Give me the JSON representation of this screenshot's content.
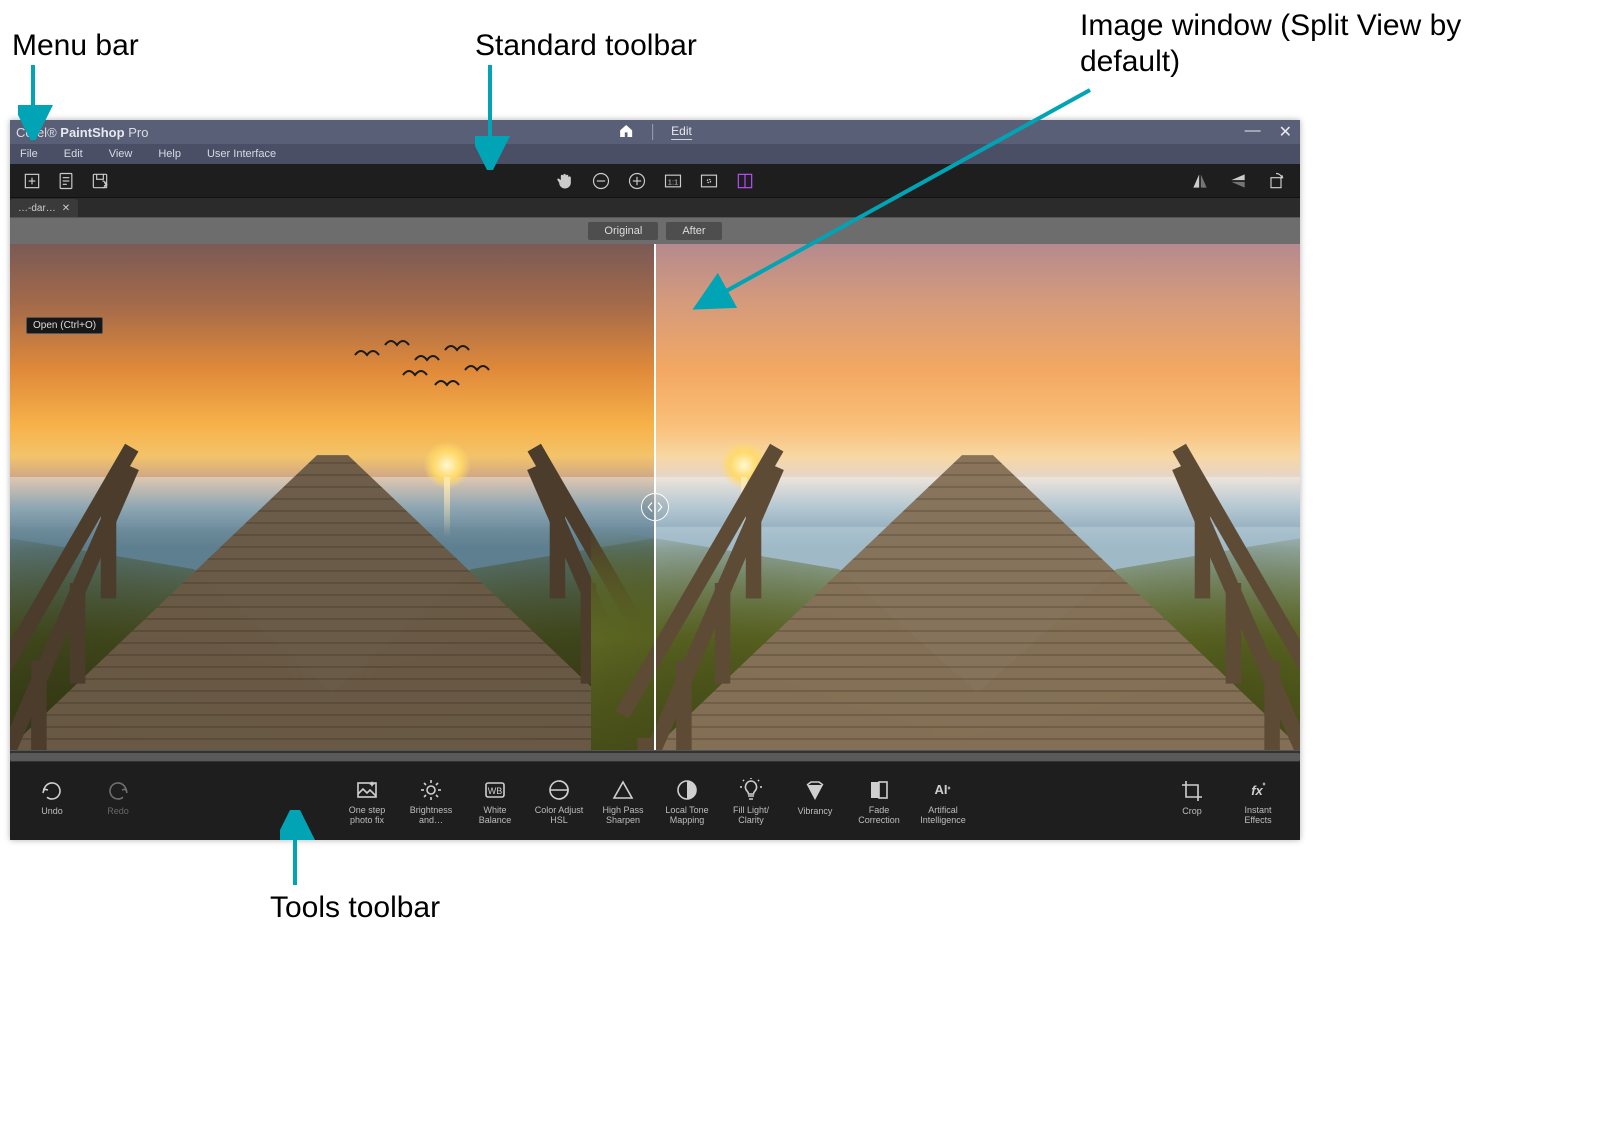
{
  "callouts": {
    "menu_bar": "Menu bar",
    "standard_toolbar": "Standard toolbar",
    "image_window": "Image window (Split View by default)",
    "tools_toolbar": "Tools toolbar"
  },
  "titlebar": {
    "brand_prefix": "Corel®",
    "brand_main": "PaintShop",
    "brand_suffix": "Pro",
    "home_tab": "Home",
    "edit_tab": "Edit",
    "minimize": "—",
    "close": "✕"
  },
  "menubar": {
    "file": "File",
    "edit": "Edit",
    "view": "View",
    "help": "Help",
    "user_interface": "User Interface"
  },
  "std_toolbar": {
    "new": "New",
    "open": "Open",
    "save": "Save",
    "pan": "Pan",
    "zoom_out": "Zoom Out",
    "zoom_in": "Zoom In",
    "actual": "1:1",
    "fit": "Fit",
    "split": "Split View",
    "flip_h": "Flip Horizontal",
    "flip_v": "Flip Vertical",
    "rotate": "Rotate"
  },
  "doc_tab": {
    "name": "…-dar…",
    "close": "✕"
  },
  "tooltip": {
    "open": "Open (Ctrl+O)"
  },
  "split": {
    "original": "Original",
    "after": "After"
  },
  "tools": {
    "undo": "Undo",
    "redo": "Redo",
    "one_step": "One step photo fix",
    "brightness": "Brightness and…",
    "white_balance": "White Balance",
    "wb_badge": "WB",
    "color_hsl": "Color Adjust HSL",
    "high_pass": "High Pass Sharpen",
    "local_tone": "Local Tone Mapping",
    "fill_light": "Fill Light/ Clarity",
    "vibrancy": "Vibrancy",
    "fade": "Fade Correction",
    "ai": "Artifical Intelligence",
    "ai_badge": "AI",
    "crop": "Crop",
    "instant": "Instant Effects"
  }
}
